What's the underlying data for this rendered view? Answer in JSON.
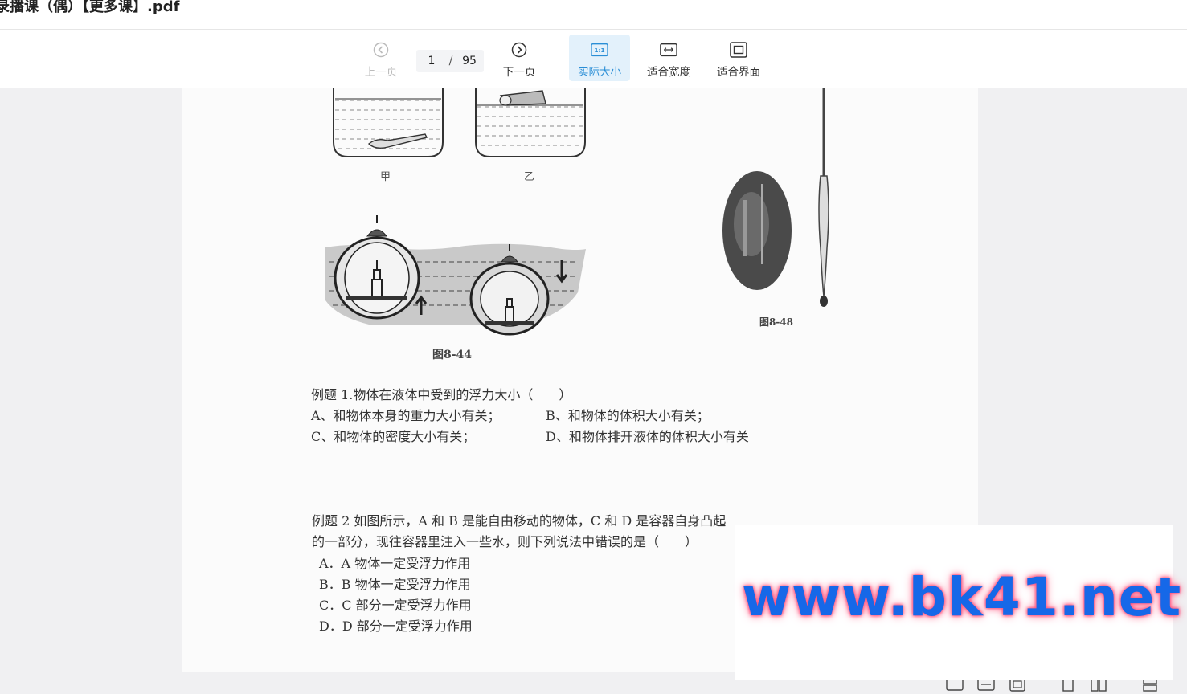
{
  "window": {
    "title": "录播课（偶）【更多课】.pdf"
  },
  "toolbar": {
    "prev_label": "上一页",
    "next_label": "下一页",
    "actual_size_label": "实际大小",
    "fit_width_label": "适合宽度",
    "fit_page_label": "适合界面",
    "current_page": "1",
    "page_separator": "/",
    "total_pages": "95",
    "actual_size_icon_text": "1:1"
  },
  "document": {
    "fig_labels": {
      "jia": "甲",
      "yi": "乙"
    },
    "fig_844": "图8-44",
    "fig_848": "图8-48",
    "example1": {
      "question": "例题 1.物体在液体中受到的浮力大小（　　）",
      "a": "A、和物体本身的重力大小有关；",
      "b": "B、和物体的体积大小有关；",
      "c": "C、和物体的密度大小有关；",
      "d": "D、和物体排开液体的体积大小有关"
    },
    "example2": {
      "line1": "例题 2 如图所示，A 和 B 是能自由移动的物体，C 和 D 是容器自身凸起",
      "line2": "的一部分，现往容器里注入一些水，则下列说法中错误的是（　　）",
      "a": "A．A 物体一定受浮力作用",
      "b": "B．B 物体一定受浮力作用",
      "c": "C．C 部分一定受浮力作用",
      "d": "D．D 部分一定受浮力作用"
    }
  },
  "watermark": {
    "text": "www.bk41.net"
  },
  "colors": {
    "accent": "#2a8ed6",
    "active_bg": "#e3f1fb",
    "watermark_text": "#1668e8",
    "watermark_glow": "#ff4d7a"
  }
}
